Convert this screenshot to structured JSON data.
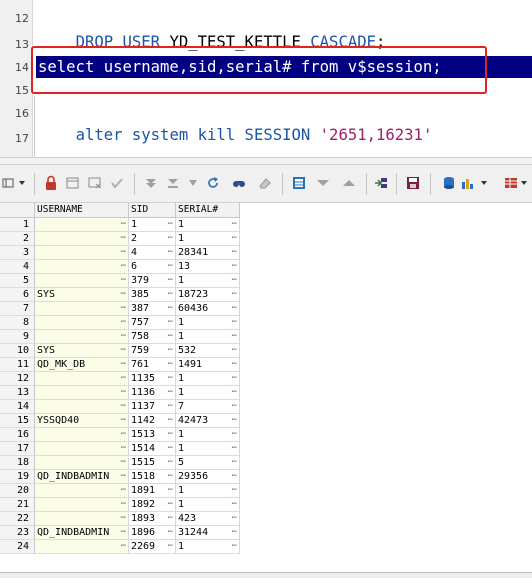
{
  "editor": {
    "lines": [
      {
        "number": "12",
        "parts": [
          [
            "kw",
            "DROP USER "
          ],
          [
            "id",
            "YD_TEST_KETTLE "
          ],
          [
            "kw",
            "CASCADE"
          ],
          [
            "id",
            ";"
          ]
        ]
      },
      {
        "number": "13",
        "parts": []
      },
      {
        "number": "14",
        "parts": [
          [
            "id",
            "select username,sid,serial# from v$session;"
          ]
        ]
      },
      {
        "number": "15",
        "parts": []
      },
      {
        "number": "16",
        "parts": [
          [
            "kw",
            "alter system kill SESSION "
          ],
          [
            "str",
            "'2651,16231'"
          ]
        ]
      },
      {
        "number": "17",
        "parts": []
      }
    ]
  },
  "toolbar": {
    "icons": [
      "layout-icon",
      "lock-icon",
      "add-record-icon",
      "delete-record-icon",
      "post-icon",
      "first-icon",
      "last-icon",
      "move-down-icon",
      "refresh-icon",
      "find-icon",
      "clear-icon",
      "grid-view-icon",
      "filter-icon",
      "sort-icon",
      "export-icon",
      "save-icon",
      "query-info-icon",
      "chart-icon",
      "table-icon"
    ]
  },
  "grid": {
    "columns": [
      "USERNAME",
      "SID",
      "SERIAL#"
    ],
    "rows": [
      {
        "n": "1",
        "user": "",
        "sid": "1",
        "serial": "1"
      },
      {
        "n": "2",
        "user": "",
        "sid": "2",
        "serial": "1"
      },
      {
        "n": "3",
        "user": "",
        "sid": "4",
        "serial": "28341"
      },
      {
        "n": "4",
        "user": "",
        "sid": "6",
        "serial": "13"
      },
      {
        "n": "5",
        "user": "",
        "sid": "379",
        "serial": "1"
      },
      {
        "n": "6",
        "user": "SYS",
        "sid": "385",
        "serial": "18723"
      },
      {
        "n": "7",
        "user": "",
        "sid": "387",
        "serial": "60436"
      },
      {
        "n": "8",
        "user": "",
        "sid": "757",
        "serial": "1"
      },
      {
        "n": "9",
        "user": "",
        "sid": "758",
        "serial": "1"
      },
      {
        "n": "10",
        "user": "SYS",
        "sid": "759",
        "serial": "532"
      },
      {
        "n": "11",
        "user": "QD_MK_DB",
        "sid": "761",
        "serial": "1491"
      },
      {
        "n": "12",
        "user": "",
        "sid": "1135",
        "serial": "1"
      },
      {
        "n": "13",
        "user": "",
        "sid": "1136",
        "serial": "1"
      },
      {
        "n": "14",
        "user": "",
        "sid": "1137",
        "serial": "7"
      },
      {
        "n": "15",
        "user": "YSSQD40",
        "sid": "1142",
        "serial": "42473"
      },
      {
        "n": "16",
        "user": "",
        "sid": "1513",
        "serial": "1"
      },
      {
        "n": "17",
        "user": "",
        "sid": "1514",
        "serial": "1"
      },
      {
        "n": "18",
        "user": "",
        "sid": "1515",
        "serial": "5"
      },
      {
        "n": "19",
        "user": "QD_INDBADMIN",
        "sid": "1518",
        "serial": "29356"
      },
      {
        "n": "20",
        "user": "",
        "sid": "1891",
        "serial": "1"
      },
      {
        "n": "21",
        "user": "",
        "sid": "1892",
        "serial": "1"
      },
      {
        "n": "22",
        "user": "",
        "sid": "1893",
        "serial": "423"
      },
      {
        "n": "23",
        "user": "QD_INDBADMIN",
        "sid": "1896",
        "serial": "31244"
      },
      {
        "n": "24",
        "user": "",
        "sid": "2269",
        "serial": "1"
      }
    ]
  },
  "colors": {
    "keyword": "#1a55a8",
    "string": "#a0206b",
    "selected_line": "#000080",
    "highlight_box": "#e02424",
    "username_column_bg": "#fbfde8"
  }
}
